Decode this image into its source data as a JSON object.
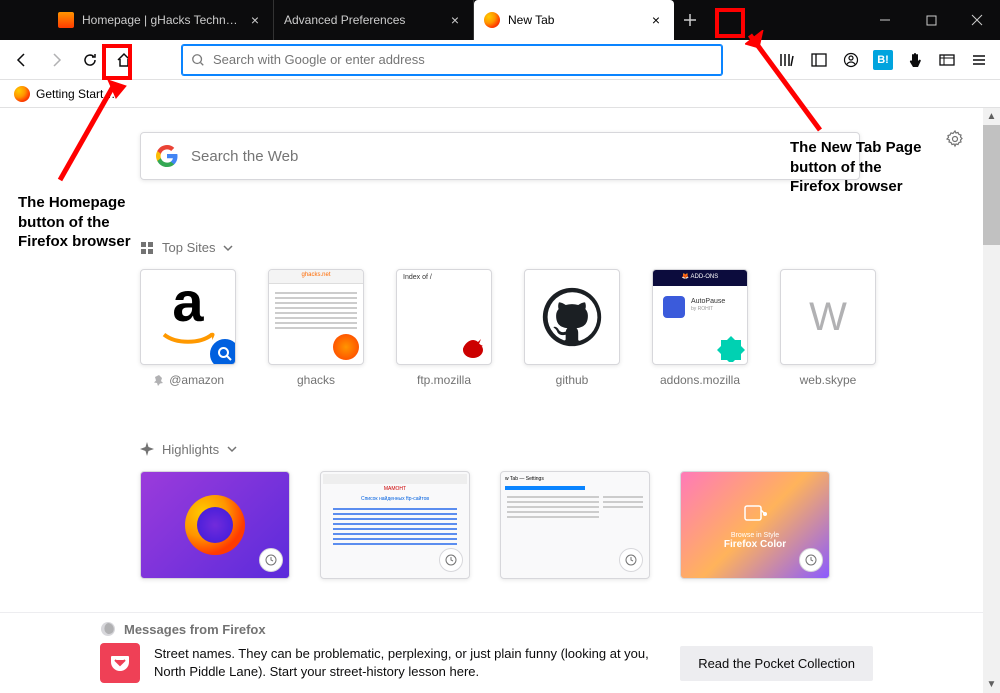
{
  "tabs": [
    {
      "label": "Homepage | gHacks Technolog",
      "active": false,
      "icon": "ghacks"
    },
    {
      "label": "Advanced Preferences",
      "active": false,
      "icon": "none"
    },
    {
      "label": "New Tab",
      "active": true,
      "icon": "firefox"
    }
  ],
  "nav": {
    "urlbar_placeholder": "Search with Google or enter address"
  },
  "bookmarks": {
    "item0": "Getting Start…"
  },
  "newtab": {
    "search_placeholder": "Search the Web",
    "topsites_label": "Top Sites",
    "highlights_label": "Highlights",
    "topsites": [
      {
        "label": "@amazon",
        "pinned": true,
        "kind": "amazon"
      },
      {
        "label": "ghacks",
        "pinned": false,
        "kind": "ghacks"
      },
      {
        "label": "ftp.mozilla",
        "pinned": false,
        "kind": "ftp"
      },
      {
        "label": "github",
        "pinned": false,
        "kind": "github"
      },
      {
        "label": "addons.mozilla",
        "pinned": false,
        "kind": "addons"
      },
      {
        "label": "web.skype",
        "pinned": false,
        "kind": "letter",
        "letter": "W"
      }
    ],
    "highlights_count": 4
  },
  "pocket": {
    "head": "Messages from Firefox",
    "text": "Street names. They can be problematic, perplexing, or just plain funny (looking at you, North Piddle Lane). Start your street-history lesson here.",
    "button": "Read the Pocket Collection"
  },
  "annotations": {
    "home_label": "The Homepage button of the Firefox browser",
    "newtab_label": "The New Tab Page button of the Firefox browser"
  }
}
